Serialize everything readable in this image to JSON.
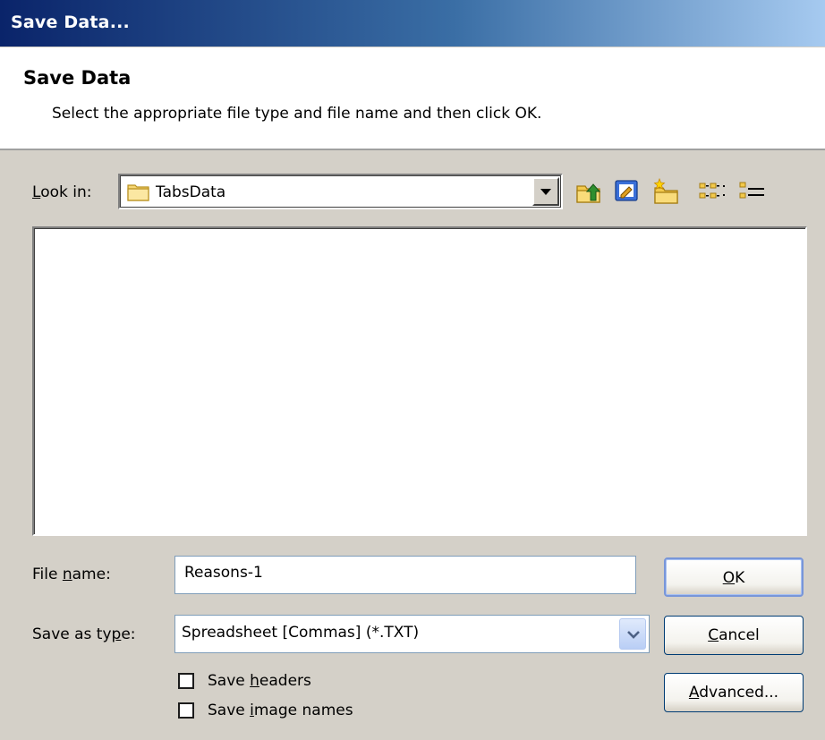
{
  "window": {
    "title": "Save Data..."
  },
  "header": {
    "title": "Save Data",
    "subtitle": "Select the appropriate file type and file name and then click OK."
  },
  "look_in": {
    "label_prefix": "",
    "label_accel": "L",
    "label_suffix": "ook in:",
    "value": "TabsData",
    "folder_icon": "folder-icon"
  },
  "toolbar": {
    "icons": [
      "up-one-level-icon",
      "view-desktop-icon",
      "new-folder-icon",
      "list-view-icon",
      "details-view-icon"
    ]
  },
  "file_name": {
    "label_prefix": "File ",
    "label_accel": "n",
    "label_suffix": "ame:",
    "value": "Reasons-1"
  },
  "save_as_type": {
    "label_prefix": "Save as ty",
    "label_accel": "p",
    "label_suffix": "e:",
    "value": "Spreadsheet [Commas] (*.TXT)"
  },
  "checkboxes": {
    "headers": {
      "prefix": "Save ",
      "accel": "h",
      "suffix": "eaders",
      "checked": false
    },
    "image_names": {
      "prefix": "Save ",
      "accel": "i",
      "suffix": "mage names",
      "checked": false
    }
  },
  "buttons": {
    "ok": {
      "prefix": "",
      "accel": "O",
      "suffix": "K"
    },
    "cancel": {
      "prefix": "",
      "accel": "C",
      "suffix": "ancel"
    },
    "advanced": {
      "prefix": "",
      "accel": "A",
      "suffix": "dvanced..."
    }
  },
  "colors": {
    "titlebar_start": "#0a246a",
    "titlebar_end": "#a6caf0",
    "dialog_face": "#d4d0c8",
    "input_border": "#7f9db9"
  }
}
